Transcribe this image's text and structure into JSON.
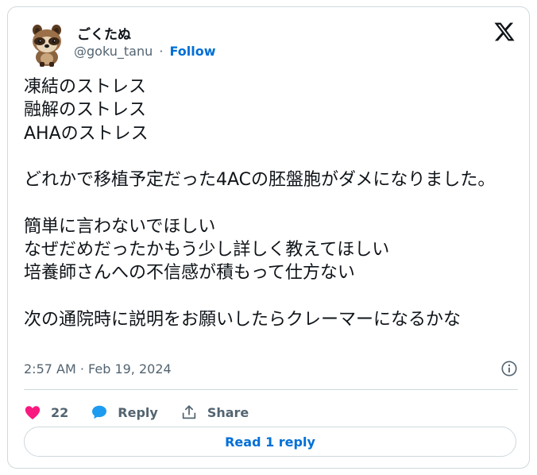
{
  "author": {
    "display_name": "ごくたぬ",
    "handle": "@goku_tanu",
    "separator": "·",
    "follow_label": "Follow",
    "avatar_icon": "tanuki-avatar-icon"
  },
  "brand": {
    "logo_icon": "x-logo-icon",
    "text_color": "#0f1419",
    "secondary_color": "#536471",
    "link_color": "#006fd6",
    "like_color": "#f91880",
    "reply_color": "#1d9bf0"
  },
  "tweet": {
    "text": "凍結のストレス\n融解のストレス\nAHAのストレス\n\nどれかで移植予定だった4ACの胚盤胞がダメになりました。\n\n簡単に言わないでほしい\nなぜだめだったかもう少し詳しく教えてほしい\n培養師さんへの不信感が積もって仕方ない\n\n次の通院時に説明をお願いしたらクレーマーになるかな",
    "timestamp": "2:57 AM · Feb 19, 2024",
    "info_icon": "info-icon"
  },
  "actions": {
    "like_count": "22",
    "reply_label": "Reply",
    "share_label": "Share"
  },
  "footer": {
    "read_replies_label": "Read 1 reply"
  }
}
